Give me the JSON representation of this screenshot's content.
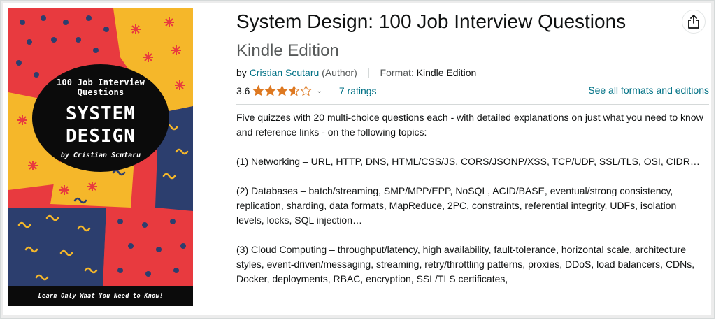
{
  "product": {
    "title": "System Design: 100 Job Interview Questions",
    "edition": "Kindle Edition",
    "by_label": "by",
    "author": "Cristian Scutaru",
    "author_role": "(Author)",
    "format_label": "Format:",
    "format_value": "Kindle Edition",
    "rating": "3.6",
    "rating_value": 3.6,
    "rating_max": 5,
    "ratings_count": "7 ratings",
    "formats_link": "See all formats and editions"
  },
  "cover": {
    "top_text": "100 Job Interview Questions",
    "title_text": "SYSTEM DESIGN",
    "author_text": "by Cristian Scutaru",
    "band_text": "Learn Only What You Need to Know!",
    "colors": {
      "red": "#e83a3f",
      "yellow": "#f5b72a",
      "navy": "#2c3e6e",
      "black": "#0b0b0b"
    }
  },
  "description": [
    "Five quizzes with 20 multi-choice questions each - with detailed explanations on just what you need to know and reference links - on the following topics:",
    "(1) Networking – URL, HTTP, DNS, HTML/CSS/JS, CORS/JSONP/XSS, TCP/UDP, SSL/TLS, OSI, CIDR…",
    "(2) Databases – batch/streaming, SMP/MPP/EPP, NoSQL, ACID/BASE, eventual/strong consistency, replication, sharding, data formats, MapReduce, 2PC, constraints, referential integrity, UDFs, isolation levels, locks, SQL injection…",
    "(3) Cloud Computing – throughput/latency, high availability, fault-tolerance, horizontal scale, architecture styles, event-driven/messaging, streaming, retry/throttling patterns, proxies, DDoS, load balancers, CDNs, Docker, deployments, RBAC, encryption, SSL/TLS certificates,"
  ],
  "icons": {
    "share": "share-icon",
    "star": "star-icon",
    "chevron": "chevron-down-icon"
  },
  "colors": {
    "link": "#007185",
    "star": "#de7921",
    "muted": "#565959"
  }
}
